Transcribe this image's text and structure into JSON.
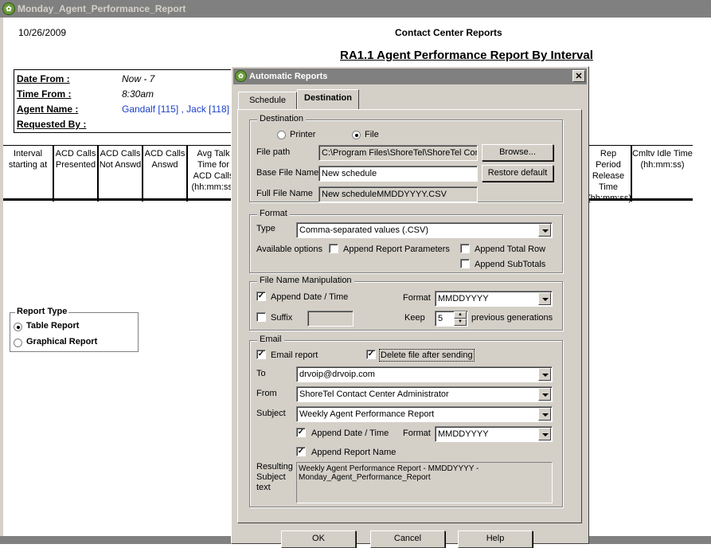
{
  "window": {
    "title": "Monday_Agent_Performance_Report",
    "icon": "app-logo-icon"
  },
  "report": {
    "date": "10/26/2009",
    "org": "Contact Center Reports",
    "title": "RA1.1 Agent Performance Report By Interval",
    "params": [
      {
        "label": "Date From :",
        "value": "Now - 7"
      },
      {
        "label": "Time From :",
        "value": "8:30am"
      },
      {
        "label": "Agent Name :",
        "value": "Gandalf [115] , Jack [118]"
      },
      {
        "label": "Requested By :",
        "value": ""
      }
    ],
    "columns": [
      "Interval starting at",
      "ACD Calls Presented",
      "ACD Calls Not Answd",
      "ACD Calls Answd",
      "Avg Talk Time for ACD Calls (hh:mm:ss)",
      "Rep Period Release Time (hh:mm:ss)",
      "Cmltv Idle Time (hh:mm:ss)"
    ],
    "report_type": {
      "legend": "Report Type",
      "options": [
        {
          "label": "Table Report",
          "selected": true
        },
        {
          "label": "Graphical Report",
          "selected": false
        }
      ]
    }
  },
  "dialog": {
    "title": "Automatic Reports",
    "close_label": "✕",
    "tabs": [
      {
        "label": "Schedule",
        "active": false
      },
      {
        "label": "Destination",
        "active": true
      }
    ],
    "destination": {
      "legend": "Destination",
      "printer_label": "Printer",
      "file_label": "File",
      "selected": "File",
      "file_path_label": "File path",
      "file_path_value": "C:\\Program Files\\ShoreTel\\ShoreTel Cont",
      "browse_label": "Browse...",
      "base_name_label": "Base File Name",
      "base_name_value": "New schedule",
      "restore_label": "Restore default",
      "full_name_label": "Full File Name",
      "full_name_value": "New scheduleMMDDYYYY.CSV"
    },
    "format": {
      "legend": "Format",
      "type_label": "Type",
      "type_value": "Comma-separated values (.CSV)",
      "options_label": "Available options",
      "append_params_label": "Append Report Parameters",
      "append_params_checked": false,
      "append_total_label": "Append Total Row",
      "append_total_checked": false,
      "append_subtotals_label": "Append SubTotals",
      "append_subtotals_checked": false
    },
    "filename": {
      "legend": "File Name Manipulation",
      "append_date_label": "Append Date / Time",
      "append_date_checked": true,
      "format_label": "Format",
      "format_value": "MMDDYYYY",
      "suffix_label": "Suffix",
      "suffix_checked": false,
      "suffix_value": "",
      "keep_label": "Keep",
      "keep_value": "5",
      "keep_suffix": "previous generations"
    },
    "email": {
      "legend": "Email",
      "email_report_label": "Email report",
      "email_report_checked": true,
      "delete_after_label": "Delete file after sending",
      "delete_after_checked": true,
      "to_label": "To",
      "to_value": "drvoip@drvoip.com",
      "from_label": "From",
      "from_value": "ShoreTel Contact Center Administrator",
      "subject_label": "Subject",
      "subject_value": "Weekly Agent Performance Report",
      "append_date_label": "Append Date / Time",
      "append_date_checked": true,
      "format_label": "Format",
      "format_value": "MMDDYYYY",
      "append_name_label": "Append Report Name",
      "append_name_checked": true,
      "result_label_1": "Resulting",
      "result_label_2": "Subject",
      "result_label_3": "text",
      "result_value": "Weekly Agent Performance Report - MMDDYYYY - Monday_Agent_Performance_Report"
    },
    "buttons": {
      "ok": "OK",
      "cancel": "Cancel",
      "help": "Help"
    }
  }
}
